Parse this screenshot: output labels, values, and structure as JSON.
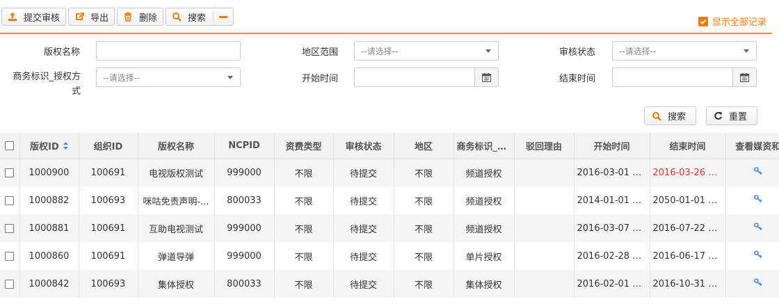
{
  "toolbar": {
    "submit_label": "提交审核",
    "export_label": "导出",
    "delete_label": "删除",
    "search_label": "搜索",
    "show_all_label": "显示全部记录"
  },
  "filters": {
    "copyright_name_label": "版权名称",
    "copyright_name_value": "",
    "region_label": "地区范围",
    "region_value": "--请选择--",
    "review_status_label": "审核状态",
    "review_status_value": "--请选择--",
    "auth_mode_label": "商务标识_授权方式",
    "auth_mode_value": "--请选择--",
    "start_time_label": "开始时间",
    "start_time_value": "",
    "end_time_label": "结束时间",
    "end_time_value": "",
    "search_button": "搜索",
    "reset_button": "重置"
  },
  "table": {
    "headers": [
      "版权ID",
      "组织ID",
      "版权名称",
      "NCPID",
      "资费类型",
      "审核状态",
      "地区",
      "商务标识_授权方式",
      "驳回理由",
      "开始时间",
      "结束时间",
      "查看媒资和"
    ],
    "rows": [
      {
        "id": "1000900",
        "org": "100691",
        "name": "电视版权测试",
        "ncpid": "999000",
        "fee": "不限",
        "status": "待提交",
        "region": "不限",
        "auth": "频道授权",
        "reason": "",
        "start": "2016-03-01 0...",
        "end": "2016-03-26 0...",
        "end_highlight": true
      },
      {
        "id": "1000882",
        "org": "100693",
        "name": "咪咕免责声明-...",
        "ncpid": "800033",
        "fee": "不限",
        "status": "待提交",
        "region": "不限",
        "auth": "频道授权",
        "reason": "",
        "start": "2014-01-01 0...",
        "end": "2050-01-01 0...",
        "end_highlight": false
      },
      {
        "id": "1000881",
        "org": "100691",
        "name": "互助电视测试",
        "ncpid": "999000",
        "fee": "不限",
        "status": "待提交",
        "region": "不限",
        "auth": "频道授权",
        "reason": "",
        "start": "2016-03-07 0...",
        "end": "2016-07-22 0...",
        "end_highlight": false
      },
      {
        "id": "1000860",
        "org": "100691",
        "name": "弹道导弹",
        "ncpid": "999000",
        "fee": "不限",
        "status": "待提交",
        "region": "不限",
        "auth": "单片授权",
        "reason": "",
        "start": "2016-02-28 0...",
        "end": "2016-06-17 0...",
        "end_highlight": false
      },
      {
        "id": "1000842",
        "org": "100693",
        "name": "集体授权",
        "ncpid": "800033",
        "fee": "不限",
        "status": "待提交",
        "region": "不限",
        "auth": "集体授权",
        "reason": "",
        "start": "2016-02-01 0...",
        "end": "2016-10-31 0...",
        "end_highlight": false
      }
    ]
  },
  "colors": {
    "accent": "#ef7a12",
    "highlight_text": "#e03030",
    "link_icon": "#3a8ee6"
  }
}
